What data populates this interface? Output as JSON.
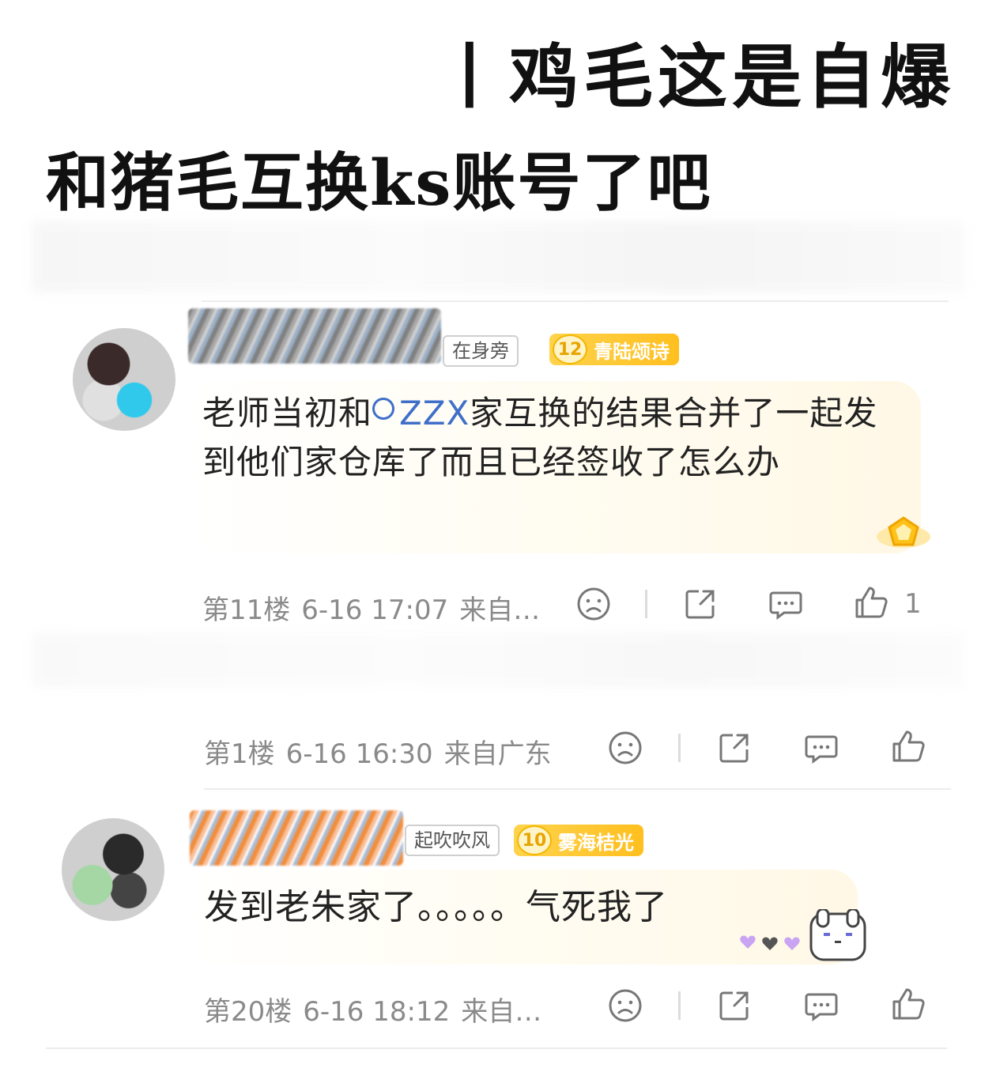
{
  "caption": {
    "line1": "丨鸡毛这是自爆",
    "line2": "和猪毛互换ks账号了吧"
  },
  "comments": [
    {
      "user_tag": "在身旁",
      "level": "12",
      "level_title": "青陆颂诗",
      "text_before": "老师当初和",
      "mention": "ZZX",
      "text_after": "家互换的结果合并了一起发到他们家仓库了而且已经签收了怎么办",
      "floor": "第11楼",
      "time": "6-16 17:07",
      "location": "来自…",
      "likes": "1"
    },
    {
      "floor": "第1楼",
      "time": "6-16 16:30",
      "location": "来自广东"
    },
    {
      "user_tag": "起吹吹风",
      "level": "10",
      "level_title": "雾海桔光",
      "text": "发到老朱家了。。。。。气死我了",
      "floor": "第20楼",
      "time": "6-16 18:12",
      "location": "来自…"
    }
  ],
  "icons": {
    "dislike": "sad-face-icon",
    "share": "share-icon",
    "reply": "comment-icon",
    "like": "thumbs-up-icon"
  },
  "colors": {
    "accent_link": "#3f6fc9",
    "badge_gold": "#ffbf1f",
    "meta_gray": "#8a8a8a"
  }
}
